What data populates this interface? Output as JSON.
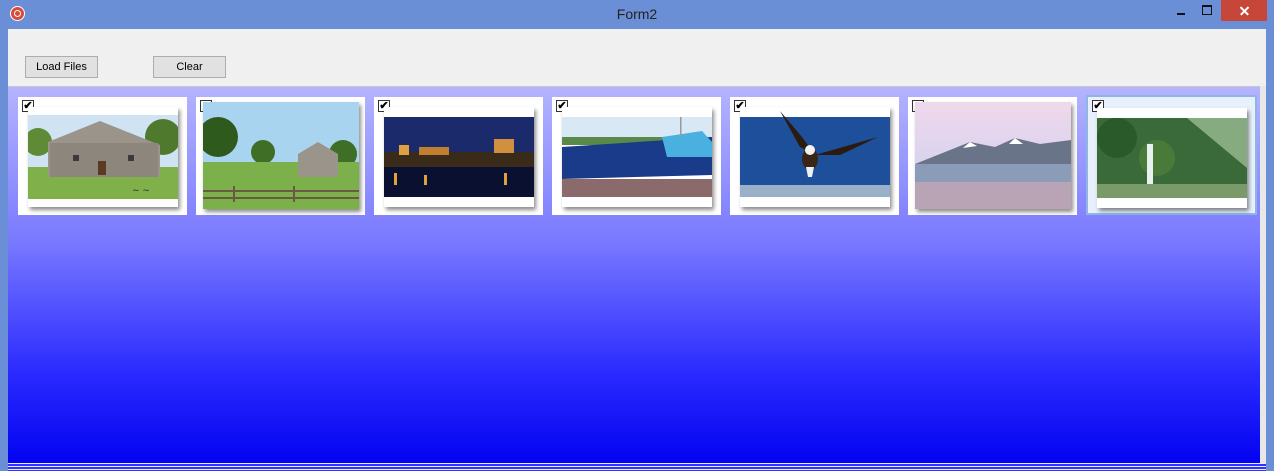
{
  "window": {
    "title": "Form2"
  },
  "toolbar": {
    "load_label": "Load Files",
    "clear_label": "Clear"
  },
  "thumbnails": [
    {
      "checked": true,
      "mark": "✔"
    },
    {
      "checked": false,
      "mark": ""
    },
    {
      "checked": true,
      "mark": "✔"
    },
    {
      "checked": true,
      "mark": "✔"
    },
    {
      "checked": true,
      "mark": "✔"
    },
    {
      "checked": false,
      "mark": ""
    },
    {
      "checked": true,
      "mark": "✔",
      "selected": true
    }
  ],
  "colors": {
    "titlebar": "#6b8fd6",
    "close": "#c7463a",
    "selection": "#8fb4e6"
  }
}
